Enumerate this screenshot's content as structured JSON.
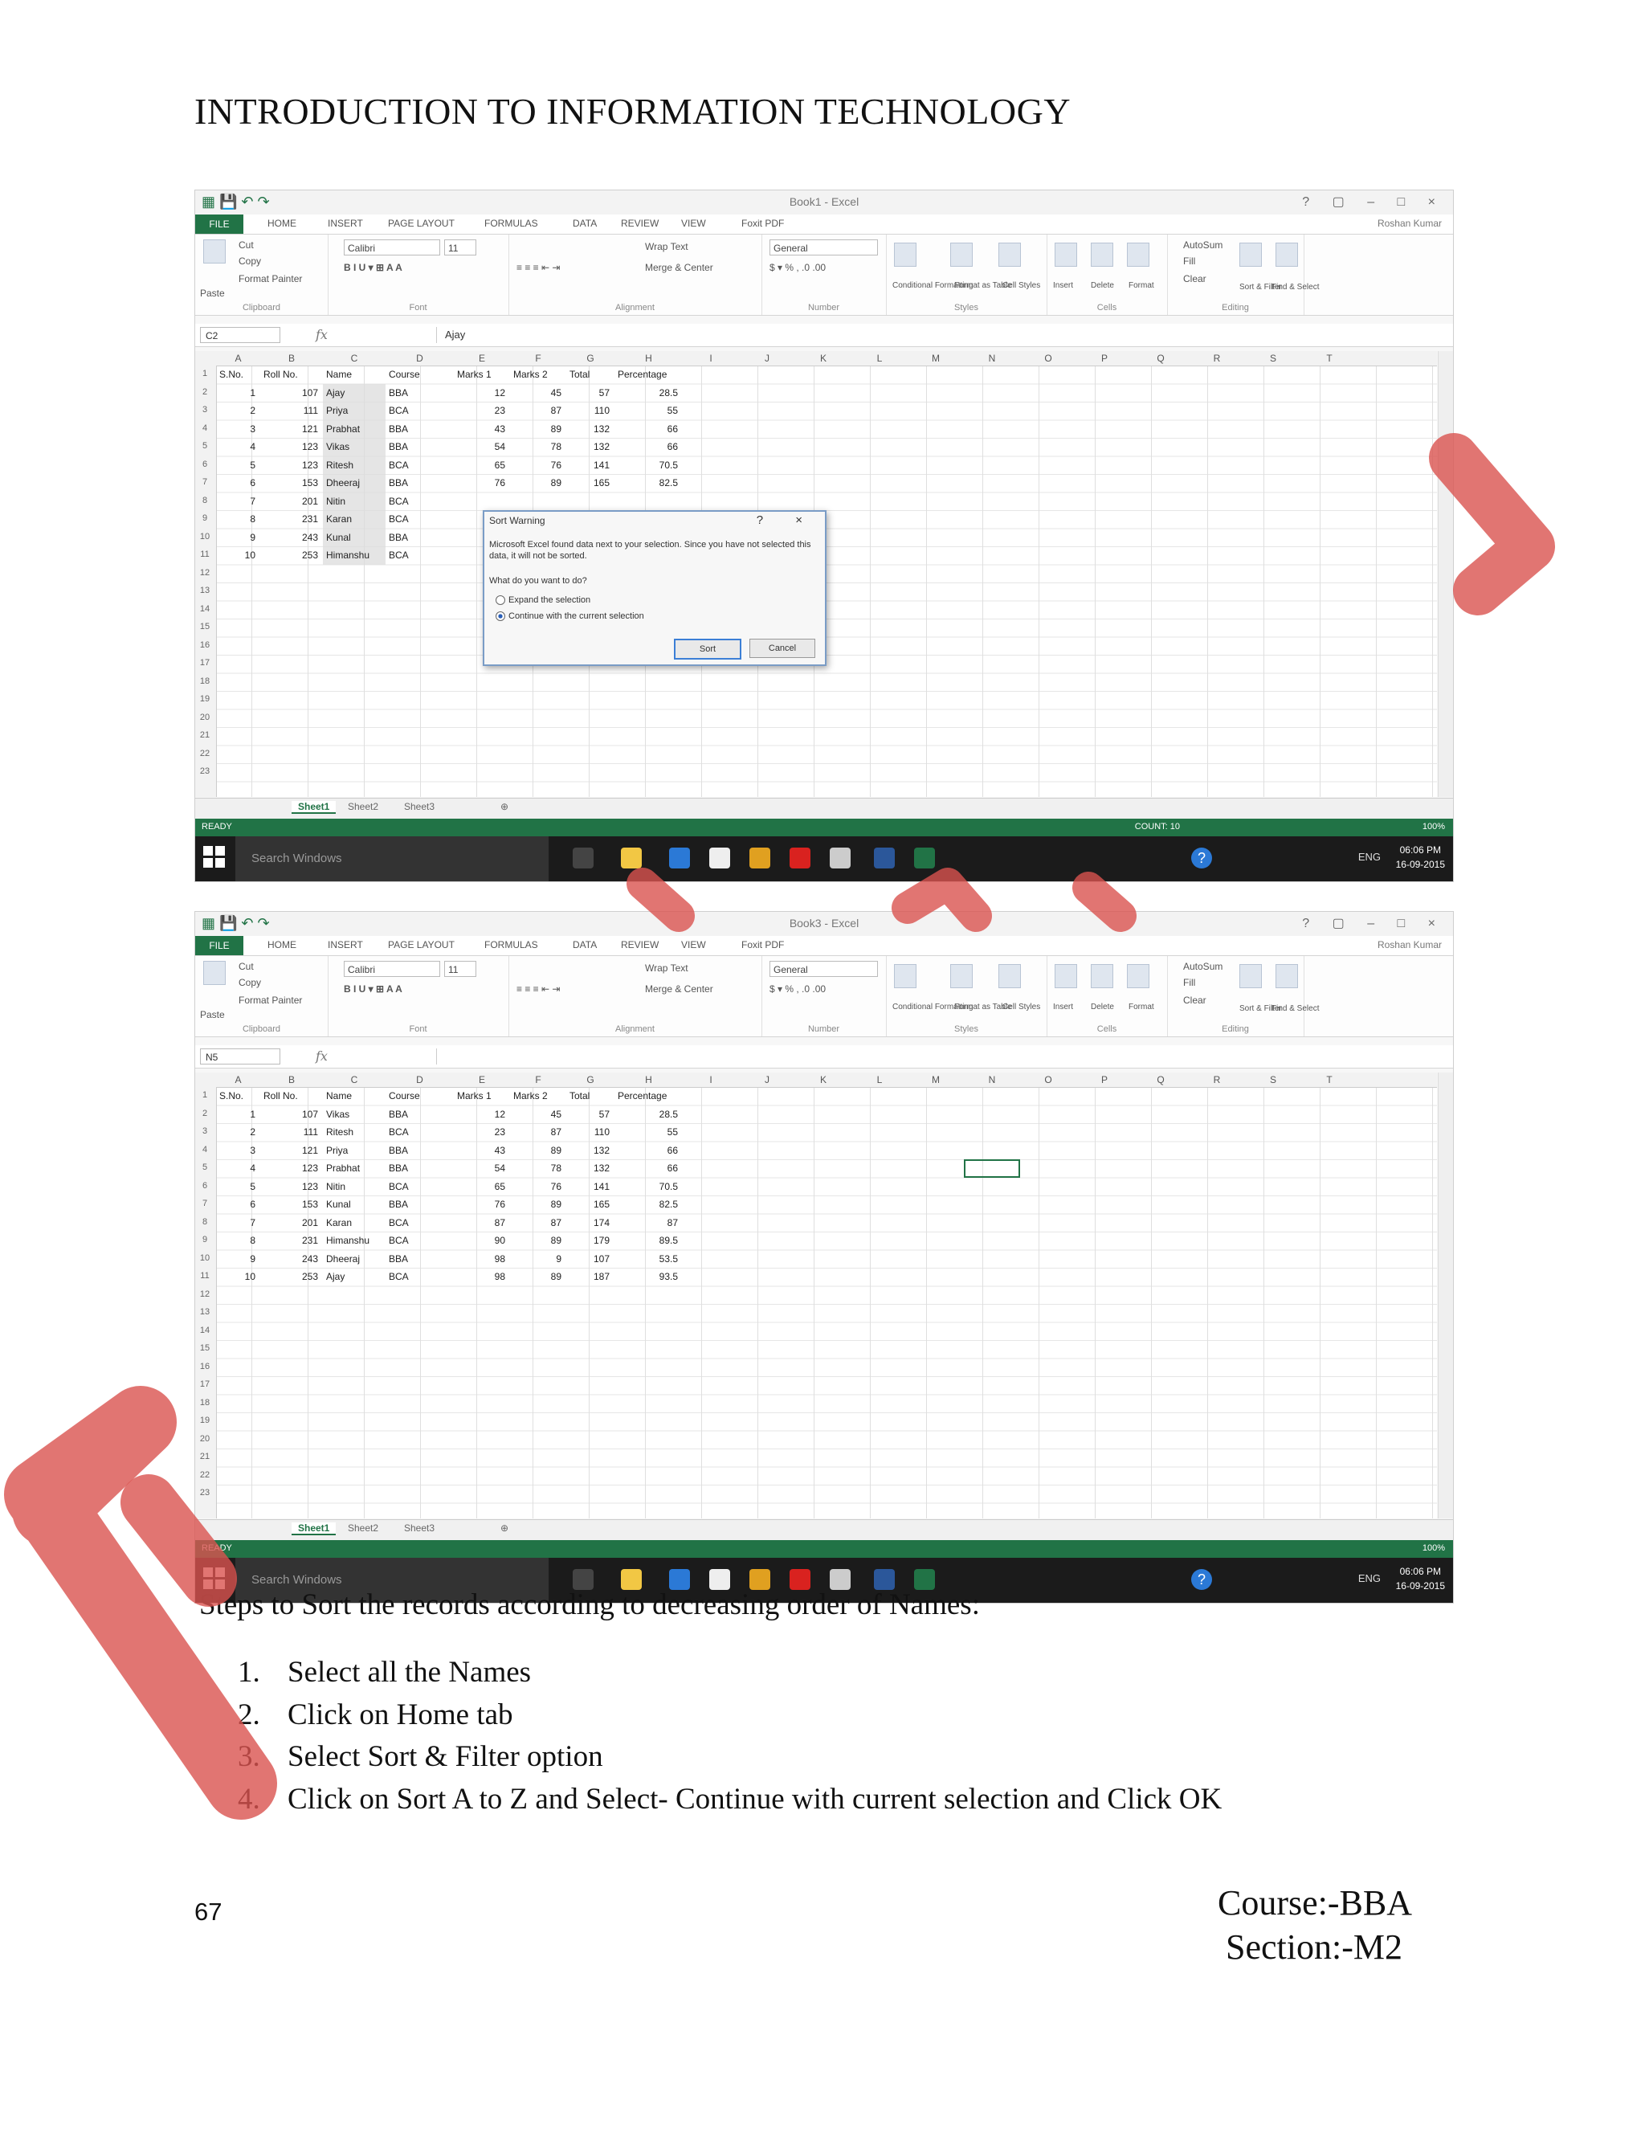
{
  "header": {
    "title": "INTRODUCTION TO INFORMATION TECHNOLOGY"
  },
  "excel": {
    "window_titles": [
      "Book1 - Excel",
      "Book3 - Excel"
    ],
    "tabs": [
      "FILE",
      "HOME",
      "INSERT",
      "PAGE LAYOUT",
      "FORMULAS",
      "DATA",
      "REVIEW",
      "VIEW",
      "Foxit PDF"
    ],
    "user": "Roshan Kumar",
    "ribbon": {
      "cut": "Cut",
      "copy": "Copy",
      "format_painter": "Format Painter",
      "paste": "Paste",
      "font_name": "Calibri",
      "font_size": "11",
      "wrap_text": "Wrap Text",
      "merge_center": "Merge & Center",
      "number_format": "General",
      "conditional_formatting": "Conditional Formatting",
      "format_as_table": "Format as Table",
      "cell_styles": "Cell Styles",
      "insert": "Insert",
      "delete": "Delete",
      "format": "Format",
      "autosum": "AutoSum",
      "fill": "Fill",
      "clear": "Clear",
      "sort_filter": "Sort & Filter",
      "find_select": "Find & Select",
      "groups": [
        "Clipboard",
        "Font",
        "Alignment",
        "Number",
        "Styles",
        "Cells",
        "Editing"
      ]
    },
    "columns": [
      "A",
      "B",
      "C",
      "D",
      "E",
      "F",
      "G",
      "H",
      "I",
      "J",
      "K",
      "L",
      "M",
      "N",
      "O",
      "P",
      "Q",
      "R",
      "S",
      "T"
    ],
    "headers": [
      "S.No.",
      "Roll No.",
      "Name",
      "Course",
      "Marks 1",
      "Marks 2",
      "Total",
      "Percentage"
    ],
    "shot1": {
      "namebox": "C2",
      "formula": "Ajay",
      "rows": [
        [
          "1",
          "107",
          "Ajay",
          "BBA",
          "12",
          "45",
          "57",
          "28.5"
        ],
        [
          "2",
          "111",
          "Priya",
          "BCA",
          "23",
          "87",
          "110",
          "55"
        ],
        [
          "3",
          "121",
          "Prabhat",
          "BBA",
          "43",
          "89",
          "132",
          "66"
        ],
        [
          "4",
          "123",
          "Vikas",
          "BBA",
          "54",
          "78",
          "132",
          "66"
        ],
        [
          "5",
          "123",
          "Ritesh",
          "BCA",
          "65",
          "76",
          "141",
          "70.5"
        ],
        [
          "6",
          "153",
          "Dheeraj",
          "BBA",
          "76",
          "89",
          "165",
          "82.5"
        ],
        [
          "7",
          "201",
          "Nitin",
          "BCA",
          "",
          "",
          "",
          ""
        ],
        [
          "8",
          "231",
          "Karan",
          "BCA",
          "",
          "",
          "",
          ""
        ],
        [
          "9",
          "243",
          "Kunal",
          "BBA",
          "",
          "",
          "",
          ""
        ],
        [
          "10",
          "253",
          "Himanshu",
          "BCA",
          "",
          "",
          "",
          ""
        ]
      ],
      "count": "COUNT: 10"
    },
    "shot2": {
      "namebox": "N5",
      "formula": "",
      "rows": [
        [
          "1",
          "107",
          "Vikas",
          "BBA",
          "12",
          "45",
          "57",
          "28.5"
        ],
        [
          "2",
          "111",
          "Ritesh",
          "BCA",
          "23",
          "87",
          "110",
          "55"
        ],
        [
          "3",
          "121",
          "Priya",
          "BBA",
          "43",
          "89",
          "132",
          "66"
        ],
        [
          "4",
          "123",
          "Prabhat",
          "BBA",
          "54",
          "78",
          "132",
          "66"
        ],
        [
          "5",
          "123",
          "Nitin",
          "BCA",
          "65",
          "76",
          "141",
          "70.5"
        ],
        [
          "6",
          "153",
          "Kunal",
          "BBA",
          "76",
          "89",
          "165",
          "82.5"
        ],
        [
          "7",
          "201",
          "Karan",
          "BCA",
          "87",
          "87",
          "174",
          "87"
        ],
        [
          "8",
          "231",
          "Himanshu",
          "BCA",
          "90",
          "89",
          "179",
          "89.5"
        ],
        [
          "9",
          "243",
          "Dheeraj",
          "BBA",
          "98",
          "9",
          "107",
          "53.5"
        ],
        [
          "10",
          "253",
          "Ajay",
          "BCA",
          "98",
          "89",
          "187",
          "93.5"
        ]
      ]
    },
    "dialog": {
      "title": "Sort Warning",
      "message": "Microsoft Excel found data next to your selection. Since you have not selected this data, it will not be sorted.",
      "question": "What do you want to do?",
      "option1": "Expand the selection",
      "option2": "Continue with the current selection",
      "sort": "Sort",
      "cancel": "Cancel"
    },
    "sheets": [
      "Sheet1",
      "Sheet2",
      "Sheet3"
    ],
    "status": {
      "ready": "READY",
      "zoom": "100%"
    },
    "taskbar": {
      "search": "Search Windows",
      "lang": "ENG",
      "time": "06:06 PM",
      "date": "16-09-2015"
    }
  },
  "steps": {
    "heading": "Steps to Sort the records according  to decreasing  order of Names:",
    "items": [
      {
        "n": "1.",
        "text": "Select all the Names"
      },
      {
        "n": "2.",
        "text": "Click  on Home tab"
      },
      {
        "n": "3.",
        "text": "Select Sort & Filter  option"
      },
      {
        "n": "4.",
        "text": "Click  on Sort A to Z and Select- Continue  with  current selection  and Click  OK"
      }
    ]
  },
  "footer": {
    "page": "67",
    "course": "Course:-BBA",
    "section": "Section:-M2"
  },
  "colors": {
    "excel_green": "#217346",
    "watermark": "#d9534f"
  }
}
